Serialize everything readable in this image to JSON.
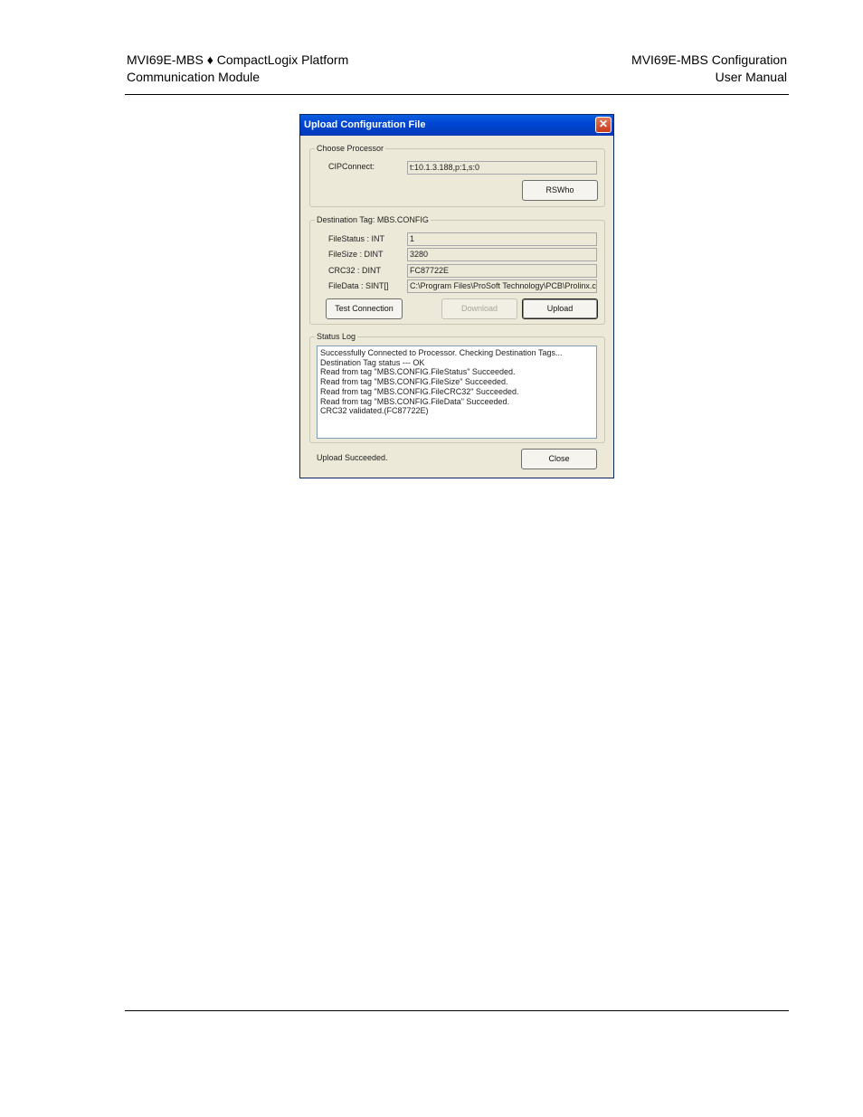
{
  "header": {
    "left_line1": "MVI69E-MBS ♦ CompactLogix Platform",
    "left_line2": "Communication Module",
    "right_line1": "MVI69E-MBS Configuration",
    "right_line2": "User Manual"
  },
  "dialog": {
    "title": "Upload Configuration File",
    "close_glyph": "✕",
    "choose_processor": {
      "label": "Choose Processor",
      "cipconnect_label": "CIPConnect:",
      "cipconnect_value": "t:10.1.3.188,p:1,s:0",
      "rswho_button": "RSWho"
    },
    "destination": {
      "label": "Destination Tag: MBS.CONFIG",
      "rows": [
        {
          "label": "FileStatus : INT",
          "value": "1"
        },
        {
          "label": "FileSize    : DINT",
          "value": "3280"
        },
        {
          "label": "CRC32     : DINT",
          "value": "FC87722E"
        },
        {
          "label": "FileData   : SINT[]",
          "value": "C:\\Program Files\\ProSoft Technology\\PCB\\Prolinx.c"
        }
      ],
      "test_button": "Test Connection",
      "download_button": "Download",
      "upload_button": "Upload"
    },
    "status_log": {
      "label": "Status Log",
      "lines": [
        "Successfully Connected to Processor. Checking Destination Tags...",
        "Destination Tag status --- OK",
        "Read from tag \"MBS.CONFIG.FileStatus\" Succeeded.",
        "Read from tag \"MBS.CONFIG.FileSize\" Succeeded.",
        "Read from tag \"MBS.CONFIG.FileCRC32\" Succeeded.",
        "Read from tag \"MBS.CONFIG.FileData\" Succeeded.",
        "CRC32 validated.(FC87722E)"
      ]
    },
    "status_text": "Upload Succeeded.",
    "close_button": "Close"
  }
}
